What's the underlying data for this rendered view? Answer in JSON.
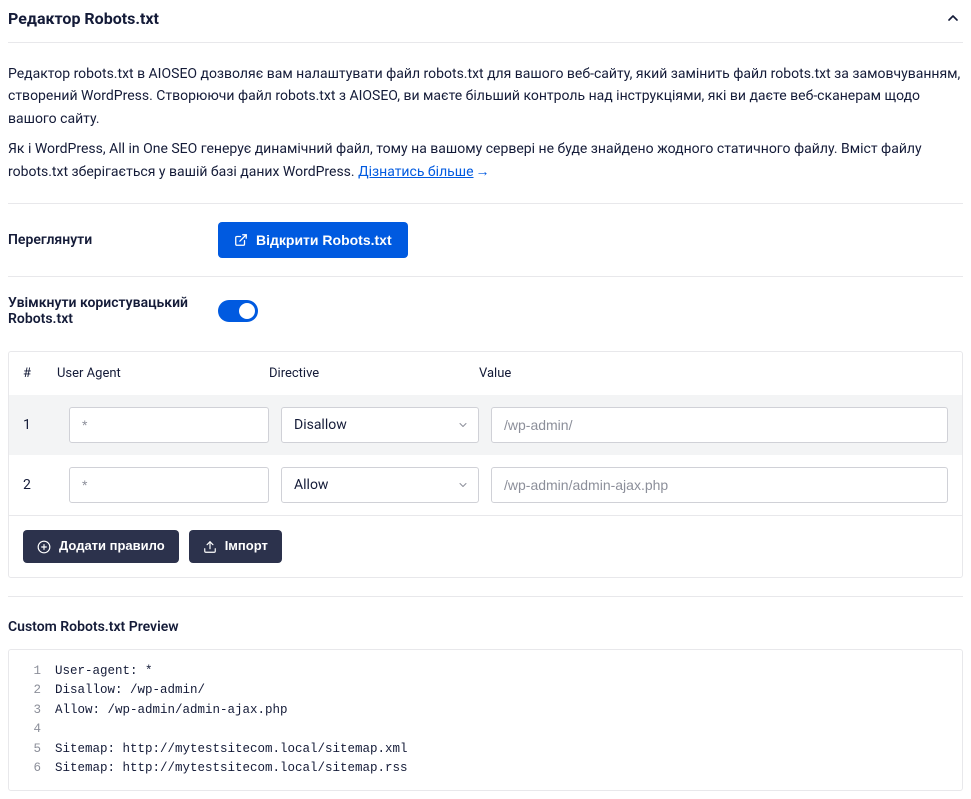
{
  "header": {
    "title": "Редактор Robots.txt"
  },
  "description": {
    "para1": "Редактор robots.txt в AIOSEO дозволяє вам налаштувати файл robots.txt для вашого веб-сайту, який замінить файл robots.txt за замовчуванням, створений WordPress. Створюючи файл robots.txt з AIOSEO, ви маєте більший контроль над інструкціями, які ви даєте веб-сканерам щодо вашого сайту.",
    "para2_prefix": "Як і WordPress, All in One SEO генерує динамічний файл, тому на вашому сервері не буде знайдено жодного статичного файлу. Вміст файлу robots.txt зберігається у вашій базі даних WordPress. ",
    "learn_more": "Дізнатись більше"
  },
  "settings": {
    "preview_label": "Переглянути",
    "open_button": "Відкрити Robots.txt",
    "enable_label": "Увімкнути користувацький Robots.txt"
  },
  "table": {
    "headers": {
      "num": "#",
      "user_agent": "User Agent",
      "directive": "Directive",
      "value": "Value"
    },
    "rows": [
      {
        "num": "1",
        "ua_placeholder": "*",
        "directive": "Disallow",
        "value_placeholder": "/wp-admin/"
      },
      {
        "num": "2",
        "ua_placeholder": "*",
        "directive": "Allow",
        "value_placeholder": "/wp-admin/admin-ajax.php"
      }
    ],
    "add_rule": "Додати правило",
    "import": "Імпорт"
  },
  "preview": {
    "title": "Custom Robots.txt Preview",
    "lines": [
      "User-agent: *",
      "Disallow: /wp-admin/",
      "Allow: /wp-admin/admin-ajax.php",
      "",
      "Sitemap: http://mytestsitecom.local/sitemap.xml",
      "Sitemap: http://mytestsitecom.local/sitemap.rss"
    ]
  }
}
